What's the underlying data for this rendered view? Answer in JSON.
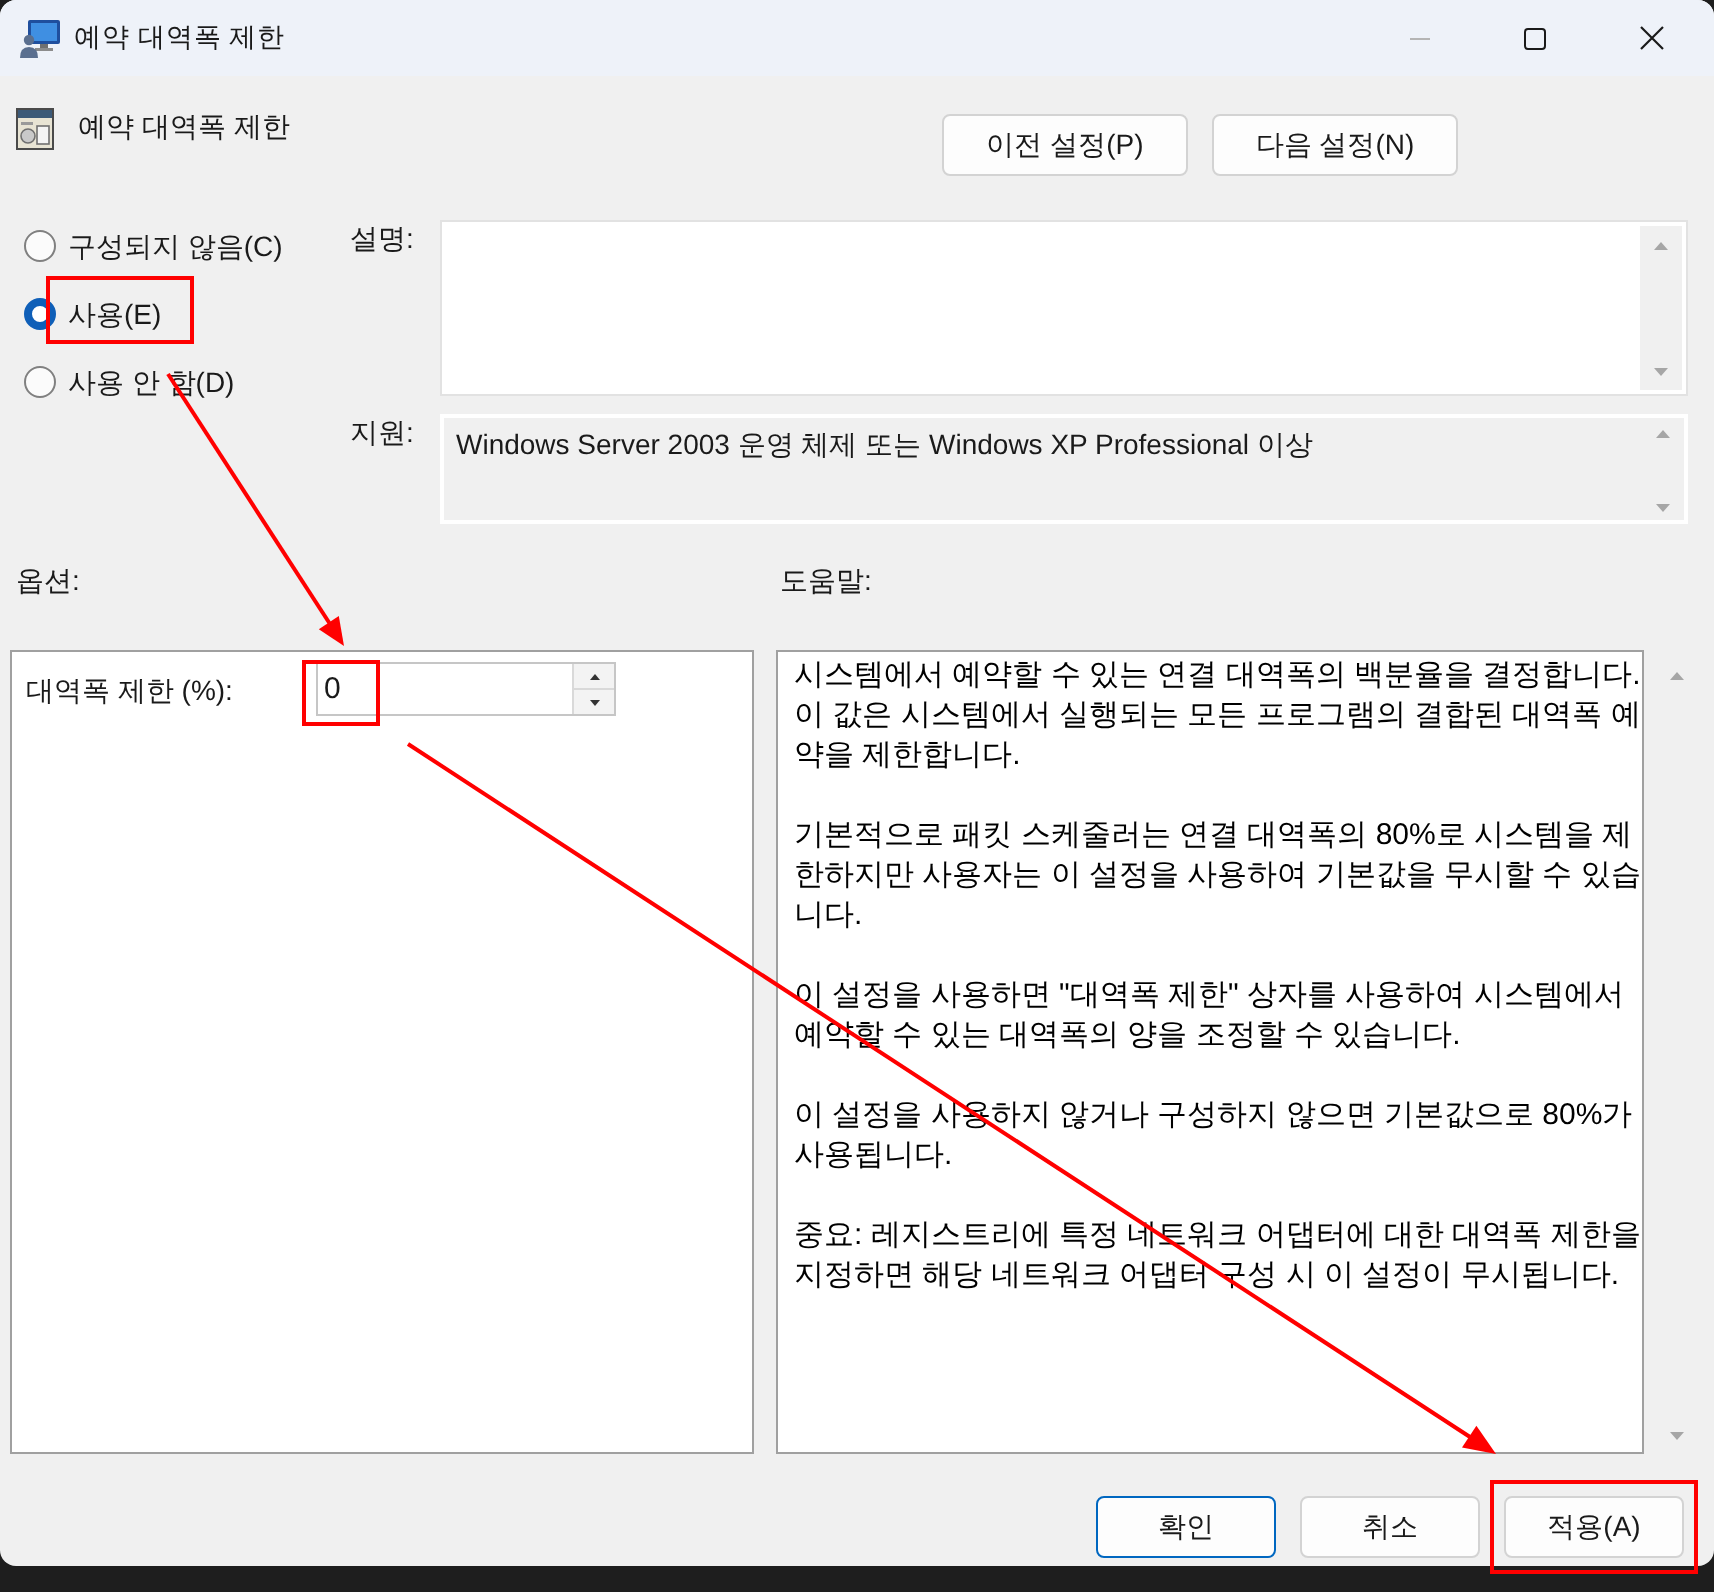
{
  "window": {
    "title": "예약 대역폭 제한"
  },
  "header": {
    "title": "예약 대역폭 제한",
    "buttons": [
      {
        "label": "이전 설정(P)"
      },
      {
        "label": "다음 설정(N)"
      }
    ]
  },
  "state_options": [
    {
      "label": "구성되지 않음(C)",
      "selected": false
    },
    {
      "label": "사용(E)",
      "selected": true
    },
    {
      "label": "사용 안 함(D)",
      "selected": false
    }
  ],
  "description": {
    "label": "설명:"
  },
  "support": {
    "label": "지원:",
    "text": "Windows Server 2003 운영 체제 또는 Windows XP Professional 이상"
  },
  "options": {
    "label": "옵션:",
    "fields": [
      {
        "label": "대역폭 제한 (%):",
        "value": "0"
      }
    ]
  },
  "help": {
    "label": "도움말:",
    "paragraphs": [
      "시스템에서 예약할 수 있는 연결 대역폭의 백분율을 결정합니다. 이 값은 시스템에서 실행되는 모든 프로그램의 결합된 대역폭 예약을 제한합니다.",
      "기본적으로 패킷 스케줄러는 연결 대역폭의 80%로 시스템을 제한하지만 사용자는 이 설정을 사용하여 기본값을 무시할 수 있습니다.",
      "이 설정을 사용하면 \"대역폭 제한\" 상자를 사용하여 시스템에서 예약할 수 있는 대역폭의 양을 조정할 수 있습니다.",
      "이 설정을 사용하지 않거나 구성하지 않으면 기본값으로 80%가 사용됩니다.",
      "중요: 레지스트리에 특정 네트워크 어댑터에 대한 대역폭 제한을 지정하면 해당 네트워크 어댑터 구성 시 이 설정이 무시됩니다."
    ]
  },
  "buttons": [
    {
      "label": "확인",
      "default": true
    },
    {
      "label": "취소",
      "default": false
    },
    {
      "label": "적용(A)",
      "default": false
    }
  ]
}
